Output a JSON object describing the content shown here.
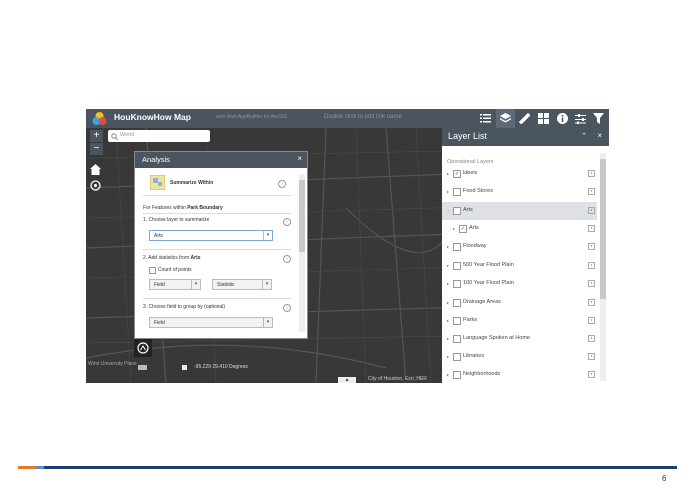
{
  "header": {
    "title": "HouKnowHow Map",
    "subtitle": "web Web AppBuilder for ArcGIS",
    "link_text": "Double click to edit link name"
  },
  "search": {
    "placeholder": "World"
  },
  "analysis": {
    "title": "Analysis",
    "close": "×",
    "tool_name": "Summarize Within",
    "features_within_prefix": "For Features within",
    "features_within_value": "Park Boundary",
    "step1": "1. Choose layer to summarize",
    "step1_value": "Arts",
    "step2_prefix": "2. Add statistics from",
    "step2_layer": "Arts",
    "count_points": "Count of points",
    "field_select": "Field",
    "statistic_select": "Statistic",
    "step3": "3. Choose field to group by (optional)",
    "step3_value": "Field"
  },
  "layer_list": {
    "title": "Layer List",
    "section": "Operational Layers",
    "layers": [
      {
        "label": "labels",
        "checked": "✓"
      },
      {
        "label": "Food Stores",
        "checked": ""
      },
      {
        "label": "Arts",
        "checked": ""
      },
      {
        "label": "Arts",
        "checked": "✓"
      },
      {
        "label": "Floodway",
        "checked": ""
      },
      {
        "label": "500 Year Flood Plain",
        "checked": ""
      },
      {
        "label": "100 Year Flood Plain",
        "checked": ""
      },
      {
        "label": "Drainage Areas",
        "checked": ""
      },
      {
        "label": "Parks",
        "checked": ""
      },
      {
        "label": "Language Spoken at Home",
        "checked": ""
      },
      {
        "label": "Libraries",
        "checked": ""
      },
      {
        "label": "Neighborhoods",
        "checked": ""
      }
    ]
  },
  "map": {
    "coords": "-95.229 29.410 Degrees",
    "place_label": "Wind University Place",
    "attribution": "City of Houston, Esri, HER"
  },
  "page_number": "6"
}
